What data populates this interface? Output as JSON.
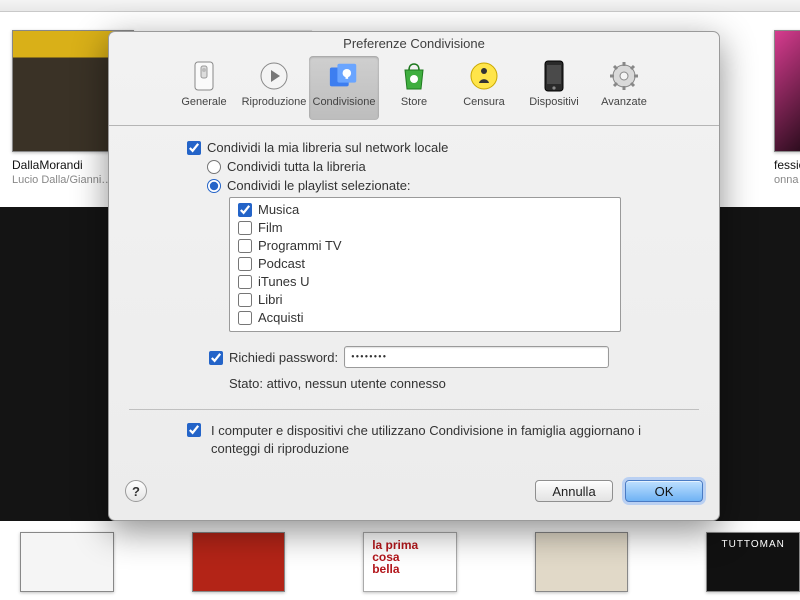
{
  "dialog": {
    "title": "Preferenze Condivisione",
    "tabs": [
      "Generale",
      "Riproduzione",
      "Condivisione",
      "Store",
      "Censura",
      "Dispositivi",
      "Avanzate"
    ],
    "cancel": "Annulla",
    "ok": "OK"
  },
  "sharing": {
    "share_library": "Condividi la mia libreria sul network locale",
    "share_all": "Condividi tutta la libreria",
    "share_selected": "Condividi le playlist selezionate:",
    "playlists": [
      "Musica",
      "Film",
      "Programmi TV",
      "Podcast",
      "iTunes U",
      "Libri",
      "Acquisti"
    ],
    "playlist_checked": [
      true,
      false,
      false,
      false,
      false,
      false,
      false
    ],
    "require_password": "Richiedi password:",
    "password_value": "••••••••",
    "status": "Stato: attivo, nessun utente connesso",
    "home_sharing": "I computer e dispositivi che utilizzano Condivisione in famiglia aggiornano i conteggi di riproduzione"
  },
  "albums_top": [
    {
      "title": "DallaMorandi",
      "subtitle": "Lucio Dalla/Gianni…"
    },
    {
      "title": "fessions on",
      "subtitle": "onna"
    }
  ]
}
